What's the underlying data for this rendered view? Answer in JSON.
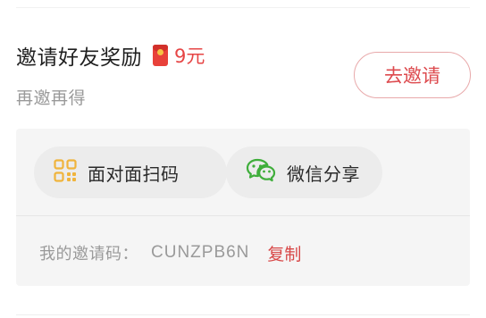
{
  "invite": {
    "title": "邀请好友奖励",
    "reward_icon": "red-envelope-icon",
    "reward": "9元",
    "subtitle": "再邀再得",
    "button_label": "去邀请"
  },
  "share": {
    "face_to_face_label": "面对面扫码",
    "face_to_face_icon": "qr-code-icon",
    "wechat_label": "微信分享",
    "wechat_icon": "wechat-icon"
  },
  "invite_code": {
    "label": "我的邀请码：",
    "value": "CUNZPB6N",
    "copy_label": "复制"
  },
  "colors": {
    "accent": "#dd4a4e",
    "qr_icon": "#f0b43c",
    "wechat_icon": "#3fae3b"
  }
}
